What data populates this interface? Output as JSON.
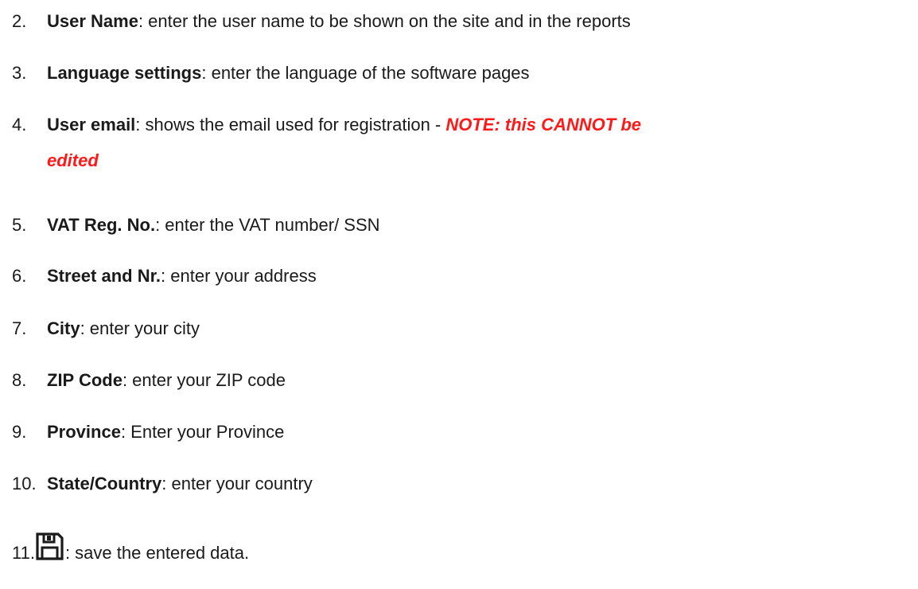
{
  "list": {
    "items": [
      {
        "number": "2.",
        "term": "User Name",
        "text": ": enter the user name to be shown on the site and in the reports"
      },
      {
        "number": "3.",
        "term": "Language settings",
        "text": ": enter the language of the software pages"
      },
      {
        "number": "4.",
        "term": "User email",
        "text": ": shows the email used for registration - ",
        "note_line1": "NOTE: this CANNOT be",
        "note_line2": "edited"
      },
      {
        "number": "5.",
        "term": "VAT Reg. No.",
        "text": ": enter the VAT number/ SSN"
      },
      {
        "number": "6.",
        "term": "Street and Nr.",
        "text": ": enter your address"
      },
      {
        "number": "7.",
        "term": "City",
        "text": ": enter your city"
      },
      {
        "number": "8.",
        "term": "ZIP Code",
        "text": ": enter your ZIP code"
      },
      {
        "number": "9.",
        "term": "Province",
        "text": ": Enter your Province"
      },
      {
        "number": "10.",
        "term": "State/Country",
        "text": ": enter your country"
      },
      {
        "number": "11.",
        "icon": "save-icon",
        "text": ": save the entered data."
      }
    ]
  },
  "colors": {
    "text": "#1a1a1a",
    "note": "#ff1a1a"
  }
}
